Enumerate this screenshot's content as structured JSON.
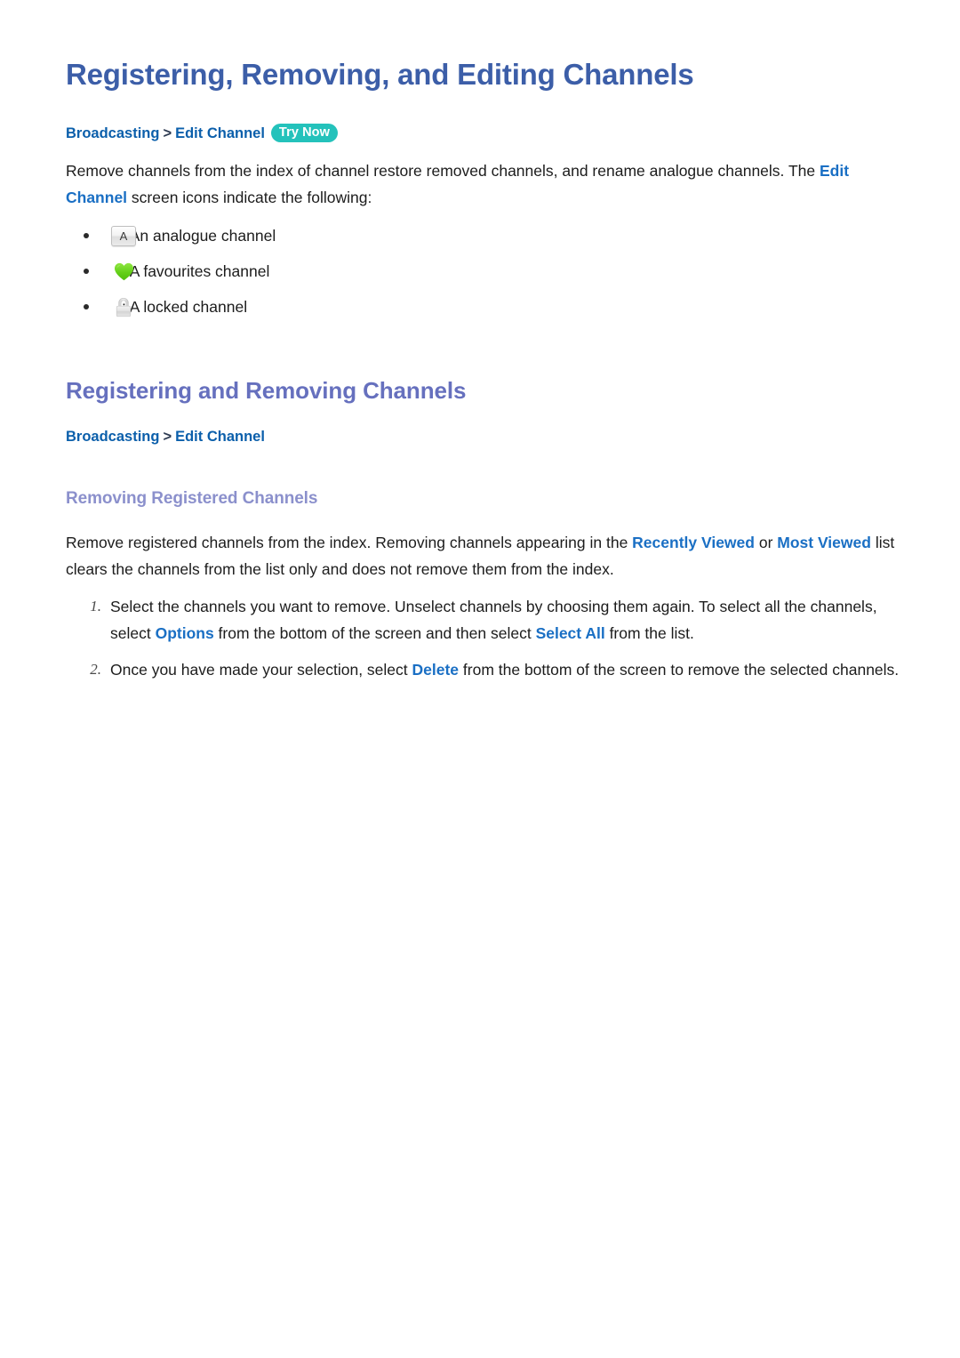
{
  "document": {
    "title": "Registering, Removing, and Editing Channels"
  },
  "breadcrumb_top": {
    "crumb1": "Broadcasting",
    "separator": ">",
    "crumb2": "Edit Channel",
    "badge": "Try Now",
    "badge_color": "#24c2bb"
  },
  "intro": {
    "part1": "Remove channels from the index of channel restore removed channels, and rename analogue channels. The ",
    "highlight1": "Edit Channel",
    "part2": " screen icons indicate the following:"
  },
  "icon_legend": [
    {
      "icon": "analogue-channel-icon",
      "glyph": "A",
      "text": ": An analogue channel"
    },
    {
      "icon": "favourite-heart-icon",
      "glyph": "",
      "text": ": A favourites channel"
    },
    {
      "icon": "locked-padlock-icon",
      "glyph": "",
      "text": ": A locked channel"
    }
  ],
  "section": {
    "heading": "Registering and Removing Channels",
    "breadcrumb": {
      "crumb1": "Broadcasting",
      "separator": ">",
      "crumb2": "Edit Channel"
    },
    "subheading": "Removing Registered Channels",
    "paragraph": {
      "part1": "Remove registered channels from the index. Removing channels appearing in the ",
      "highlight1": "Recently Viewed",
      "part2": " or ",
      "highlight2": "Most Viewed",
      "part3": " list clears the channels from the list only and does not remove them from the index."
    },
    "steps": [
      {
        "number": "1.",
        "part1": "Select the channels you want to remove. Unselect channels by choosing them again. To select all the channels, select ",
        "highlight1": "Options",
        "part2": " from the bottom of the screen and then select ",
        "highlight2": "Select All",
        "part3": " from the list."
      },
      {
        "number": "2.",
        "part1": "Once you have made your selection, select ",
        "highlight1": "Delete",
        "part2": " from the bottom of the screen to remove the selected channels.",
        "highlight2": "",
        "part3": ""
      }
    ]
  },
  "colors": {
    "h1": "#3c5ea8",
    "h2": "#6670be",
    "h3": "#8b90cc",
    "link": "#1a6fc4",
    "breadcrumb": "#0b5fab",
    "badge": "#24c2bb",
    "heart": "#63cf18",
    "text": "#1c1c1c"
  }
}
